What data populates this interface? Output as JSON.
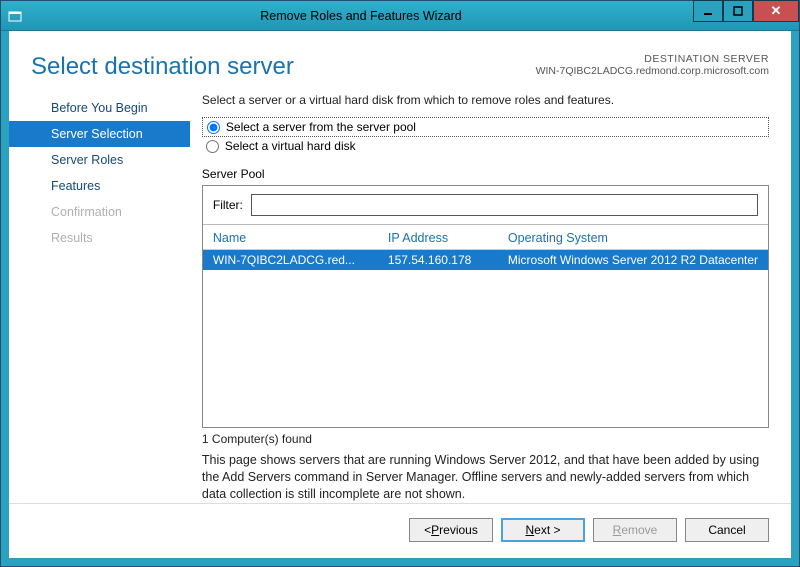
{
  "window": {
    "title": "Remove Roles and Features Wizard"
  },
  "header": {
    "title": "Select destination server",
    "dest_label": "DESTINATION SERVER",
    "dest_value": "WIN-7QIBC2LADCG.redmond.corp.microsoft.com"
  },
  "sidebar": {
    "items": [
      {
        "label": "Before You Begin",
        "state": "normal"
      },
      {
        "label": "Server Selection",
        "state": "selected"
      },
      {
        "label": "Server Roles",
        "state": "normal"
      },
      {
        "label": "Features",
        "state": "normal"
      },
      {
        "label": "Confirmation",
        "state": "disabled"
      },
      {
        "label": "Results",
        "state": "disabled"
      }
    ]
  },
  "main": {
    "intro": "Select a server or a virtual hard disk from which to remove roles and features.",
    "radio_pool": "Select a server from the server pool",
    "radio_vhd": "Select a virtual hard disk",
    "server_pool_label": "Server Pool",
    "filter_label": "Filter:",
    "columns": {
      "name": "Name",
      "ip": "IP Address",
      "os": "Operating System"
    },
    "rows": [
      {
        "name": "WIN-7QIBC2LADCG.red...",
        "ip": "157.54.160.178",
        "os": "Microsoft Windows Server 2012 R2 Datacenter"
      }
    ],
    "found": "1 Computer(s) found",
    "notes": "This page shows servers that are running Windows Server 2012, and that have been added by using the Add Servers command in Server Manager. Offline servers and newly-added servers from which data collection is still incomplete are not shown."
  },
  "footer": {
    "previous_prefix": "< ",
    "previous_letter": "P",
    "previous_rest": "revious",
    "next_letter": "N",
    "next_rest": "ext >",
    "remove_letter": "R",
    "remove_rest": "emove",
    "cancel": "Cancel"
  }
}
